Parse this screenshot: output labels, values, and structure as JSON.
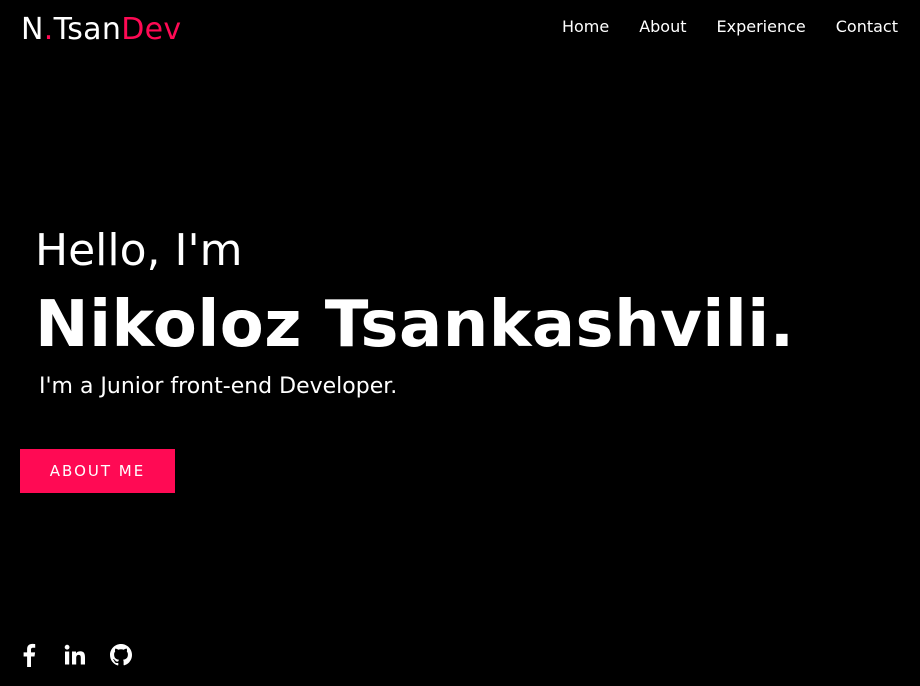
{
  "header": {
    "logo": {
      "part1": "N",
      "dot": ".",
      "part2": "Tsan",
      "part3": "Dev"
    },
    "nav": [
      {
        "label": "Home"
      },
      {
        "label": "About"
      },
      {
        "label": "Experience"
      },
      {
        "label": "Contact"
      }
    ]
  },
  "hero": {
    "greeting": "Hello, I'm",
    "name": "Nikoloz Tsankashvili.",
    "tagline": "I'm a Junior front-end Developer.",
    "cta_label": "ABOUT ME"
  },
  "social": [
    {
      "icon": "facebook-icon"
    },
    {
      "icon": "linkedin-icon"
    },
    {
      "icon": "github-icon"
    }
  ],
  "colors": {
    "background": "#000000",
    "text": "#ffffff",
    "accent": "#ff0a54"
  }
}
